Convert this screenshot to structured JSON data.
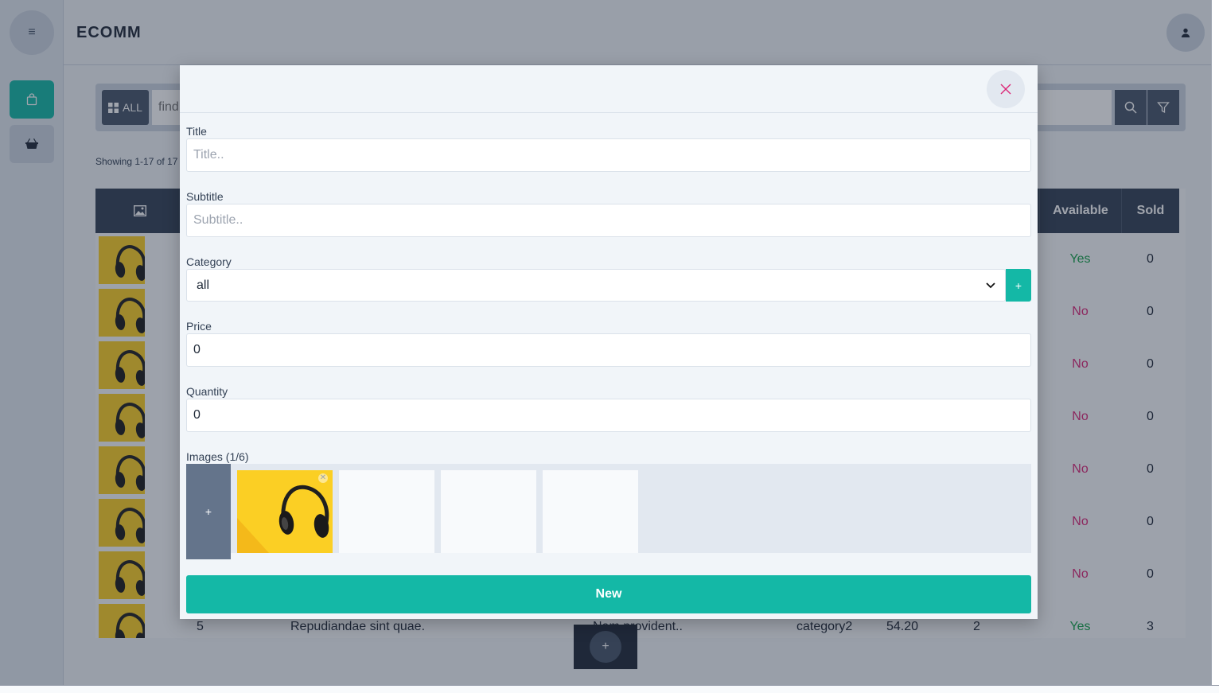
{
  "sidebar": {
    "menu_icon": "menu-icon",
    "items": [
      {
        "icon": "shopping-bag-icon",
        "active": true
      },
      {
        "icon": "basket-icon",
        "active": false
      }
    ]
  },
  "header": {
    "brand": "ECOMM",
    "user_icon": "user-icon"
  },
  "search": {
    "all_label": "ALL",
    "placeholder": "find"
  },
  "showing_text": "Showing 1-17 of 17",
  "table": {
    "columns": {
      "available": "Available",
      "sold": "Sold"
    },
    "rows": [
      {
        "available": "Yes",
        "sold": "0"
      },
      {
        "available": "No",
        "sold": "0"
      },
      {
        "available": "No",
        "sold": "0"
      },
      {
        "available": "No",
        "sold": "0"
      },
      {
        "available": "No",
        "sold": "0"
      },
      {
        "available": "No",
        "sold": "0"
      },
      {
        "available": "No",
        "sold": "0"
      },
      {
        "id": "5",
        "title": "Repudiandae sint quae.",
        "subtitle": "Nam provident..",
        "category": "category2",
        "price": "54.20",
        "quantity": "2",
        "available": "Yes",
        "sold": "3"
      }
    ]
  },
  "modal": {
    "title_label": "Title",
    "title_placeholder": "Title..",
    "subtitle_label": "Subtitle",
    "subtitle_placeholder": "Subtitle..",
    "category_label": "Category",
    "category_value": "all",
    "add_category_label": "+",
    "price_label": "Price",
    "price_value": "0",
    "quantity_label": "Quantity",
    "quantity_value": "0",
    "images_label": "Images (1/6)",
    "add_image_label": "+",
    "submit_label": "New"
  },
  "fab_label": "+",
  "colors": {
    "accent": "#14b8a6",
    "header_dark": "#334155",
    "yes": "#16a34a",
    "no": "#db2777"
  }
}
